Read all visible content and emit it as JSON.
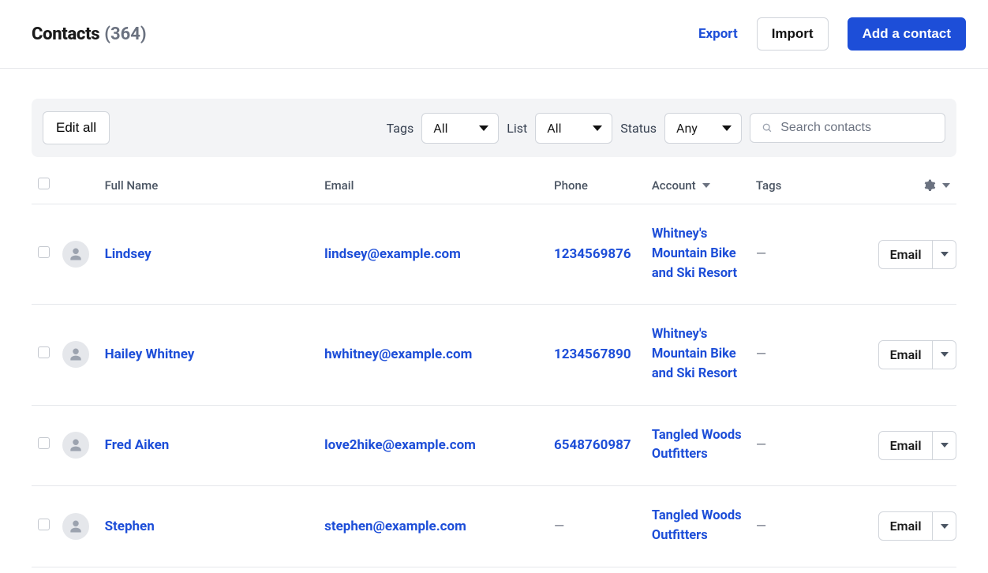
{
  "header": {
    "title": "Contacts",
    "count_display": "(364)",
    "export_label": "Export",
    "import_label": "Import",
    "add_label": "Add a contact"
  },
  "filters": {
    "edit_all_label": "Edit all",
    "tags_label": "Tags",
    "tags_value": "All",
    "list_label": "List",
    "list_value": "All",
    "status_label": "Status",
    "status_value": "Any",
    "search_placeholder": "Search contacts"
  },
  "columns": {
    "full_name": "Full Name",
    "email": "Email",
    "phone": "Phone",
    "account": "Account",
    "tags": "Tags"
  },
  "row_action_label": "Email",
  "rows": [
    {
      "name": "Lindsey",
      "email": "lindsey@example.com",
      "phone": "1234569876",
      "account": "Whitney's Mountain Bike and Ski Resort",
      "tags": "—"
    },
    {
      "name": "Hailey Whitney",
      "email": "hwhitney@example.com",
      "phone": "1234567890",
      "account": "Whitney's Mountain Bike and Ski Resort",
      "tags": "—"
    },
    {
      "name": "Fred Aiken",
      "email": "love2hike@example.com",
      "phone": "6548760987",
      "account": "Tangled Woods Outfitters",
      "tags": "—"
    },
    {
      "name": "Stephen",
      "email": "stephen@example.com",
      "phone": "—",
      "account": "Tangled Woods Outfitters",
      "tags": "—"
    }
  ]
}
